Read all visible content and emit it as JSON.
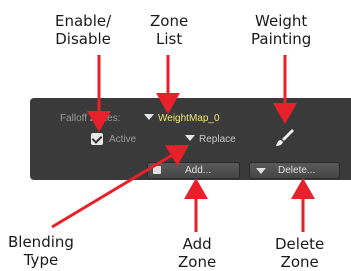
{
  "callouts": {
    "enable_disable": "Enable/\nDisable",
    "zone_list": "Zone\nList",
    "weight_painting": "Weight\nPainting",
    "blending_type": "Blending\nType",
    "add_zone": "Add\nZone",
    "delete_zone": "Delete\nZone"
  },
  "panel": {
    "falloff_label": "Falloff Zones:",
    "zone_selected": "WeightMap_0",
    "active_label": "Active",
    "active_checked": true,
    "blend_mode": "Replace",
    "add_button": "Add...",
    "delete_button": "Delete..."
  },
  "colors": {
    "arrow": "#e8202a",
    "panel_bg": "#3a3a3a",
    "zone_value": "#f0e87a"
  },
  "icons": {
    "zone_dropdown": "triangle-down-icon",
    "blend_dropdown": "triangle-down-icon",
    "weight_paint": "paint-brush-icon",
    "active": "checkbox-checked-icon",
    "add": "add-zone-icon",
    "delete": "triangle-down-icon"
  }
}
